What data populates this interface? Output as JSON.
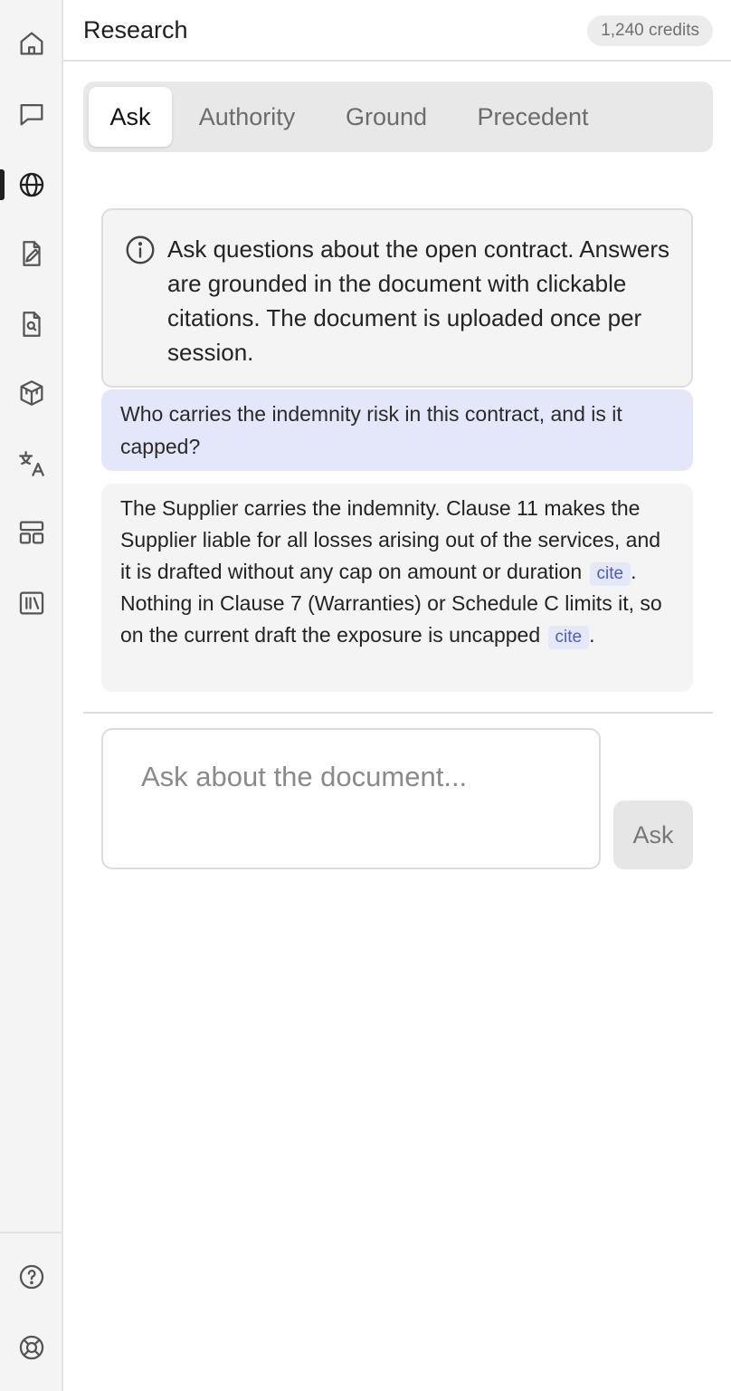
{
  "header": {
    "title": "Research",
    "credits": "1,240 credits"
  },
  "sidebar": {
    "items": [
      {
        "icon": "home-icon"
      },
      {
        "icon": "chat-icon"
      },
      {
        "icon": "globe-icon",
        "active": true
      },
      {
        "icon": "document-edit-icon"
      },
      {
        "icon": "document-search-icon"
      },
      {
        "icon": "cube-icon"
      },
      {
        "icon": "translate-icon"
      },
      {
        "icon": "layout-icon"
      },
      {
        "icon": "library-icon"
      }
    ],
    "bottom_items": [
      {
        "icon": "help-icon"
      },
      {
        "icon": "lifebuoy-icon"
      }
    ]
  },
  "tabs": [
    {
      "label": "Ask",
      "active": true
    },
    {
      "label": "Authority"
    },
    {
      "label": "Ground"
    },
    {
      "label": "Precedent"
    }
  ],
  "info": {
    "icon": "info-icon",
    "text": "Ask questions about the open contract. Answers are grounded in the document with clickable citations. The document is uploaded once per session."
  },
  "conversation": {
    "user_message": "Who carries the indemnity risk in this contract, and is it capped?",
    "assistant_message": {
      "part1": "The Supplier carries the indemnity. Clause 11 makes the Supplier liable for all losses arising out of the services, and it is drafted without any cap on amount or duration",
      "cite1": "cite",
      "part2": ". Nothing in Clause 7 (Warranties) or Schedule C limits it, so on the current draft the exposure is uncapped",
      "cite2": "cite",
      "part3": "."
    }
  },
  "composer": {
    "placeholder": "Ask about the document...",
    "value": "",
    "submit_label": "Ask"
  },
  "colors": {
    "accent_user_bubble": "#e4e7f9",
    "cite_text": "#4a5bc8",
    "sidebar_bg": "#f4f4f4"
  }
}
